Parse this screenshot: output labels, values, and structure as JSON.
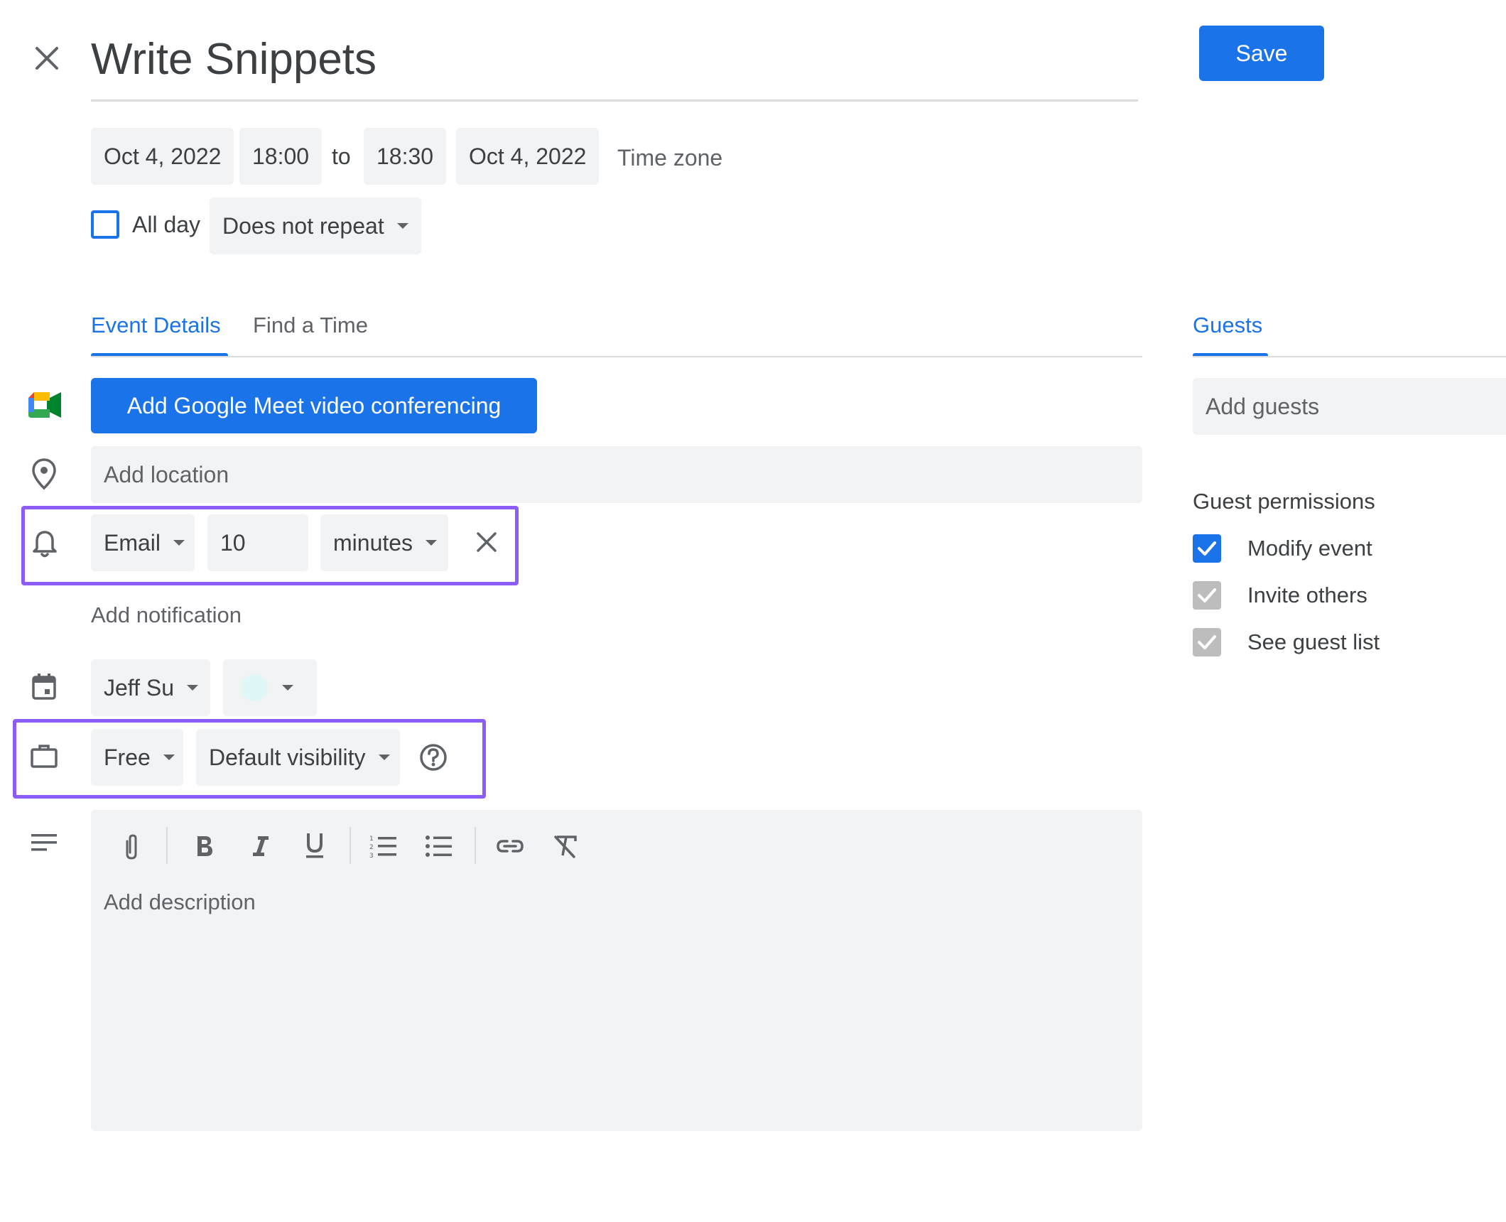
{
  "header": {
    "title": "Write Snippets",
    "save_label": "Save",
    "close_icon": "close-icon"
  },
  "datetime": {
    "start_date": "Oct 4, 2022",
    "start_time": "18:00",
    "to_label": "to",
    "end_time": "18:30",
    "end_date": "Oct 4, 2022",
    "timezone_label": "Time zone",
    "all_day_label": "All day",
    "all_day_checked": false,
    "repeat_value": "Does not repeat"
  },
  "tabs": [
    {
      "label": "Event Details",
      "active": true
    },
    {
      "label": "Find a Time",
      "active": false
    }
  ],
  "details": {
    "meet_button_label": "Add Google Meet video conferencing",
    "location_placeholder": "Add location",
    "notification": {
      "method": "Email",
      "amount": "10",
      "unit": "minutes"
    },
    "add_notification_label": "Add notification",
    "calendar_owner": "Jeff Su",
    "calendar_color": "#e0f7f7",
    "availability": "Free",
    "visibility": "Default visibility",
    "description_placeholder": "Add description",
    "toolbar_icons": [
      "attachment-icon",
      "bold-icon",
      "italic-icon",
      "underline-icon",
      "numbered-list-icon",
      "bulleted-list-icon",
      "link-icon",
      "remove-formatting-icon"
    ]
  },
  "guests": {
    "tab_label": "Guests",
    "add_placeholder": "Add guests",
    "permissions_title": "Guest permissions",
    "permissions": [
      {
        "label": "Modify event",
        "checked": true,
        "enabled": true
      },
      {
        "label": "Invite others",
        "checked": true,
        "enabled": false
      },
      {
        "label": "See guest list",
        "checked": true,
        "enabled": false
      }
    ]
  },
  "colors": {
    "accent": "#1a73e8",
    "highlight": "#8b5cf6",
    "field_bg": "#f1f3f4"
  }
}
